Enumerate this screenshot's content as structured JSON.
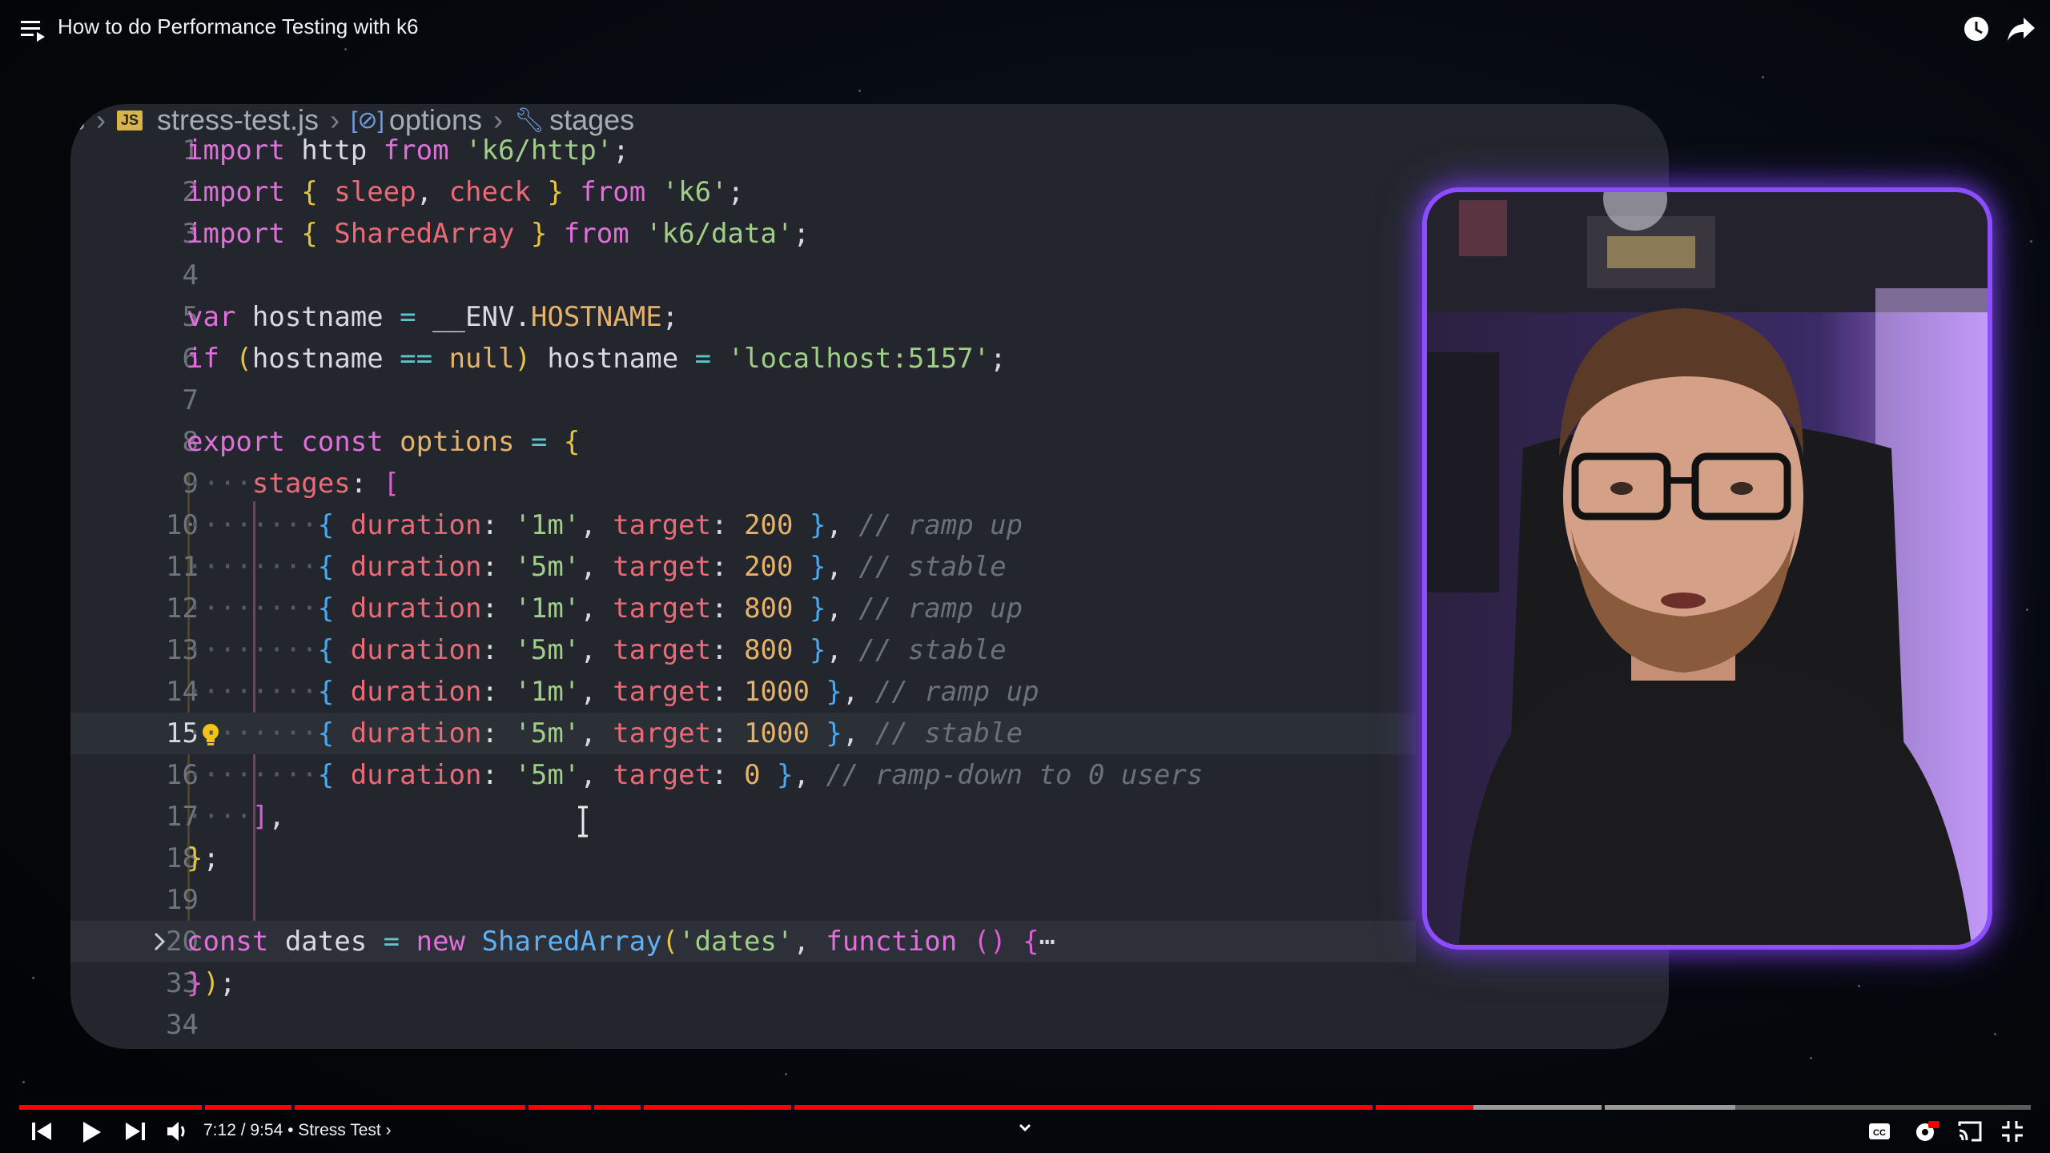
{
  "player": {
    "title": "How to do Performance Testing with k6",
    "time_current": "7:12",
    "time_total": "9:54",
    "time_text": "7:12 / 9:54 • Stress Test ›",
    "chapter": "Stress Test",
    "progress_fraction": 0.723
  },
  "editor": {
    "breadcrumb": {
      "partial": "s",
      "file": "stress-test.js",
      "file_badge": "JS",
      "symbol1": "options",
      "symbol2": "stages"
    },
    "line_numbers": [
      "1",
      "2",
      "3",
      "4",
      "5",
      "6",
      "7",
      "8",
      "9",
      "10",
      "11",
      "12",
      "13",
      "14",
      "15",
      "16",
      "17",
      "18",
      "19",
      "20",
      "33",
      "34"
    ],
    "active_line": "15",
    "lines": {
      "l1": {
        "a": "import",
        "b": " http ",
        "c": "from",
        "d": " 'k6/http'",
        "e": ";"
      },
      "l2": {
        "a": "import",
        "b": " { ",
        "c": "sleep",
        "d": ", ",
        "e": "check",
        "f": " } ",
        "g": "from",
        "h": " 'k6'",
        "i": ";"
      },
      "l3": {
        "a": "import",
        "b": " { ",
        "c": "SharedArray",
        "d": " } ",
        "e": "from",
        "f": " 'k6/data'",
        "g": ";"
      },
      "l5": {
        "a": "var",
        "b": " hostname ",
        "c": "=",
        "d": " __ENV.",
        "e": "HOSTNAME",
        "f": ";"
      },
      "l6": {
        "a": "if",
        "b": " (",
        "c": "hostname ",
        "d": "==",
        "e": " null",
        "f": ")",
        "g": " hostname ",
        "h": "=",
        "i": " 'localhost:5157'",
        "j": ";"
      },
      "l8": {
        "a": "export",
        "b": " const ",
        "c": "options",
        "d": " = ",
        "e": "{"
      },
      "l9": {
        "a": "stages",
        "b": ": ",
        "c": "["
      },
      "stages": [
        {
          "duration": "'1m'",
          "target": "200",
          "comment": "// ramp up"
        },
        {
          "duration": "'5m'",
          "target": "200",
          "comment": "// stable"
        },
        {
          "duration": "'1m'",
          "target": "800",
          "comment": "// ramp up"
        },
        {
          "duration": "'5m'",
          "target": "800",
          "comment": "// stable"
        },
        {
          "duration": "'1m'",
          "target": "1000",
          "comment": "// ramp up"
        },
        {
          "duration": "'5m'",
          "target": "1000",
          "comment": "// stable"
        },
        {
          "duration": "'5m'",
          "target": "0",
          "comment": "// ramp-down to 0 users"
        }
      ],
      "kw_duration": "duration",
      "kw_target": "target",
      "l17": {
        "a": "]",
        "b": ","
      },
      "l18": {
        "a": "}",
        "b": ";"
      },
      "l20": {
        "a": "const",
        "b": " dates ",
        "c": "=",
        "d": " new ",
        "e": "SharedArray",
        "f": "(",
        "g": "'dates'",
        "h": ", ",
        "i": "function",
        "j": " () ",
        "k": "{",
        "l": "⋯"
      },
      "l33": {
        "a": "}",
        "b": ")",
        "c": ";"
      }
    }
  },
  "icons": {
    "playlist": "playlist-icon",
    "watch_later": "clock-icon",
    "share": "share-icon",
    "prev": "skip-previous-icon",
    "play": "play-icon",
    "next": "skip-next-icon",
    "volume": "volume-icon",
    "chapters": "chevron-down-icon",
    "captions": "captions-icon",
    "settings": "gear-icon",
    "cast": "cast-icon",
    "fullscreen": "exit-fullscreen-icon"
  },
  "colors": {
    "accent_red": "#ff0000",
    "webcam_border": "#8b4dff",
    "editor_bg": "#23262c"
  }
}
